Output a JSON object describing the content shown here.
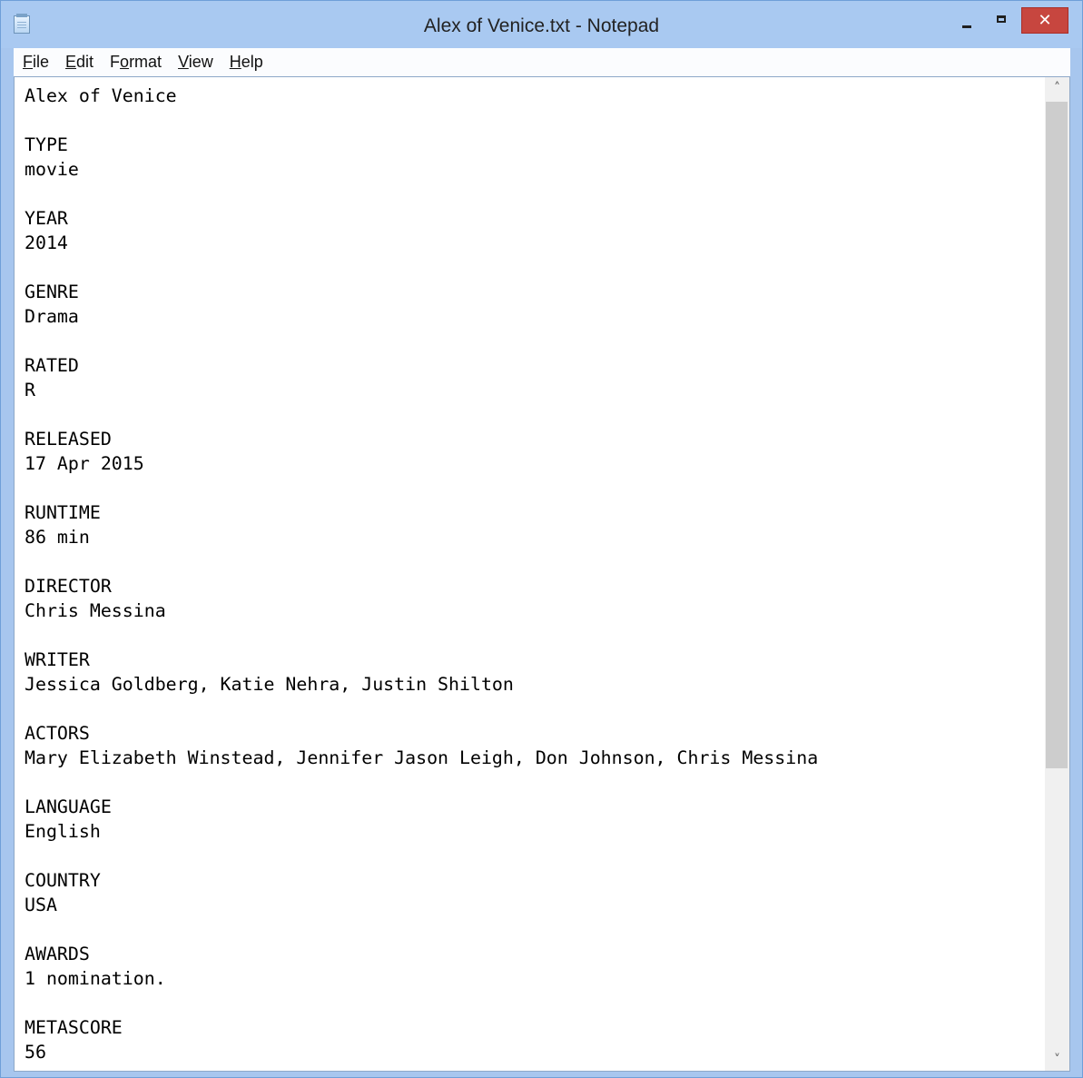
{
  "window": {
    "title": "Alex of Venice.txt - Notepad",
    "close_glyph": "✕"
  },
  "menu": {
    "file": {
      "mnemonic": "F",
      "rest": "ile"
    },
    "edit": {
      "mnemonic": "E",
      "rest": "dit"
    },
    "format": {
      "prefix": "F",
      "mnemonic": "o",
      "rest": "rmat"
    },
    "view": {
      "mnemonic": "V",
      "rest": "iew"
    },
    "help": {
      "mnemonic": "H",
      "rest": "elp"
    }
  },
  "document": {
    "text": "Alex of Venice\n\nTYPE\nmovie\n\nYEAR\n2014\n\nGENRE\nDrama\n\nRATED\nR\n\nRELEASED\n17 Apr 2015\n\nRUNTIME\n86 min\n\nDIRECTOR\nChris Messina\n\nWRITER\nJessica Goldberg, Katie Nehra, Justin Shilton\n\nACTORS\nMary Elizabeth Winstead, Jennifer Jason Leigh, Don Johnson, Chris Messina\n\nLANGUAGE\nEnglish\n\nCOUNTRY\nUSA\n\nAWARDS\n1 nomination.\n\nMETASCORE\n56"
  },
  "scrollbar": {
    "up_glyph": "˄",
    "down_glyph": "˅",
    "position_fraction": 0.0,
    "visible_fraction": 0.67
  },
  "colors": {
    "titlebar": "#a9c9f1",
    "close_button": "#c7463f",
    "scroll_thumb": "#cdcdcd"
  }
}
